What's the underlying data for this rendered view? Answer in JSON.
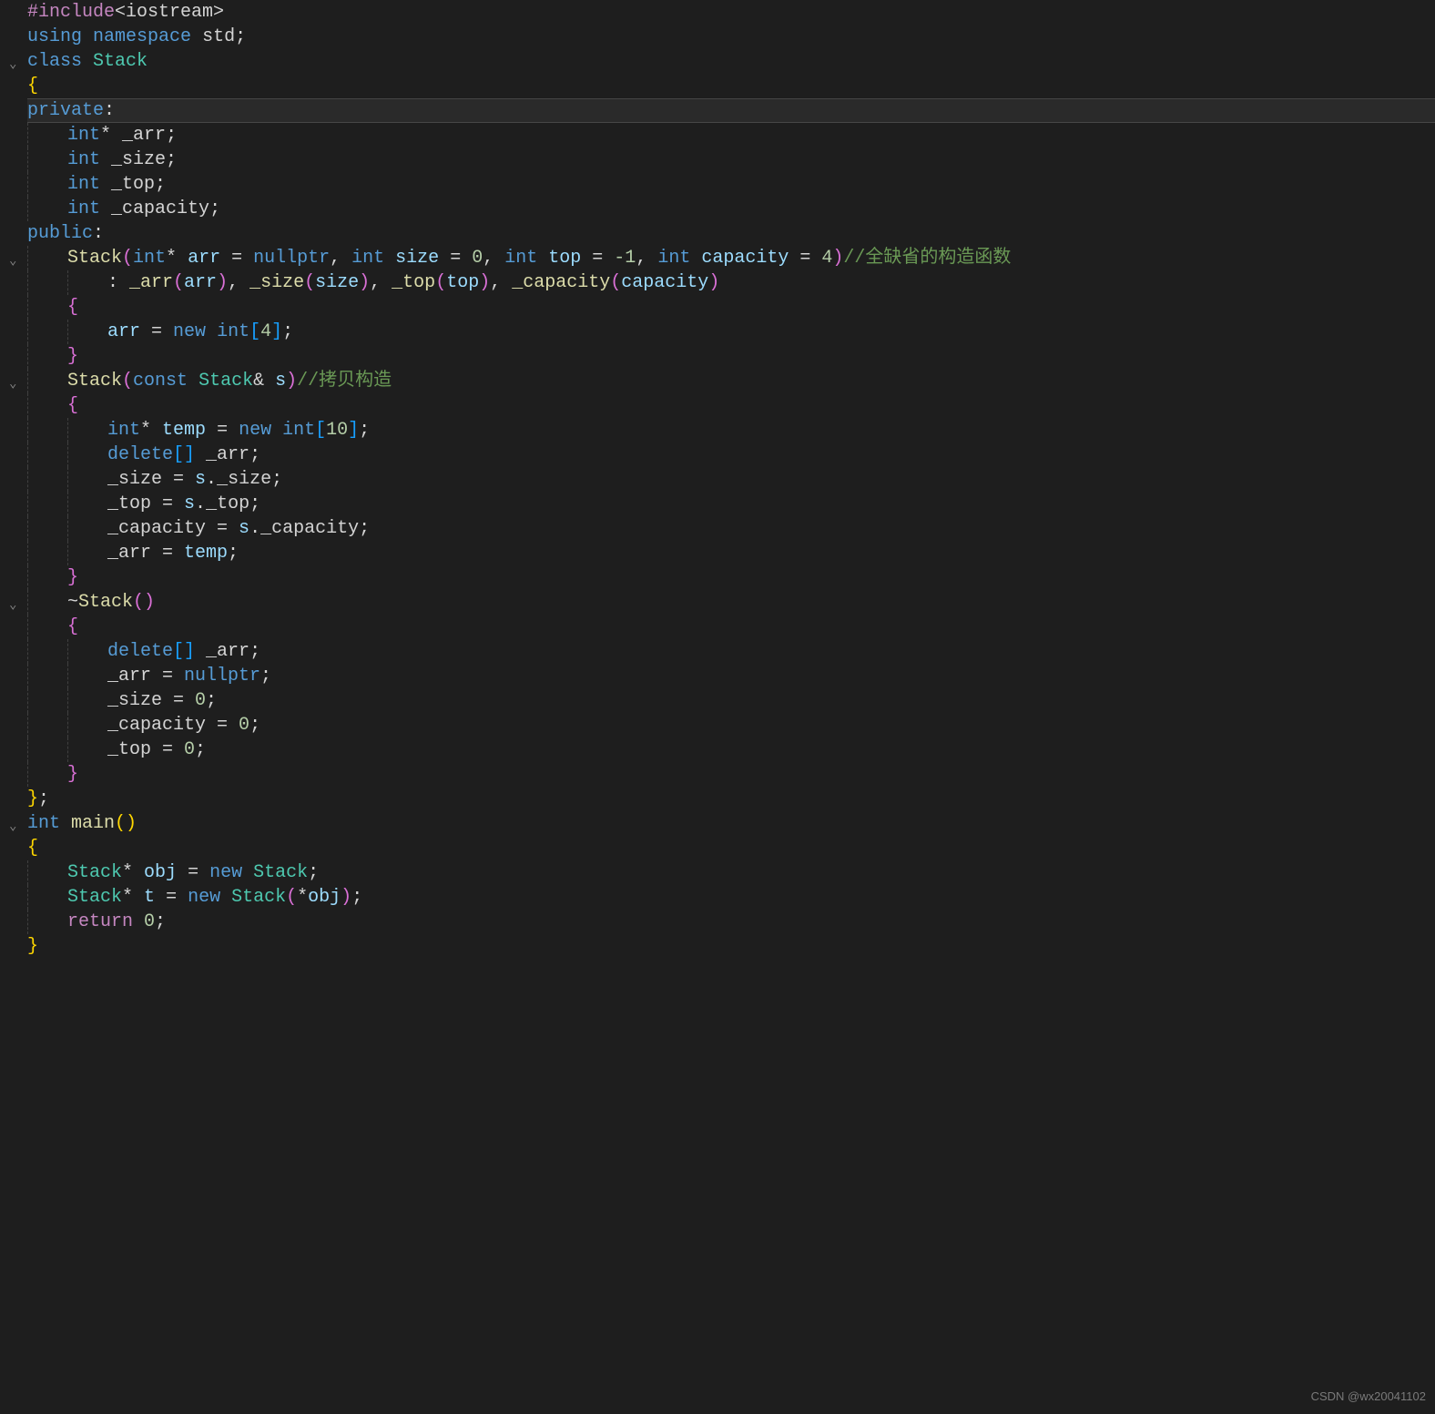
{
  "watermark": "CSDN @wx20041102",
  "lines": [
    {
      "indent": 0,
      "fold": "",
      "tokens": [
        {
          "t": "#include",
          "c": "c-preproc"
        },
        {
          "t": "<iostream>",
          "c": "c-punct"
        }
      ]
    },
    {
      "indent": 0,
      "fold": "",
      "tokens": [
        {
          "t": "using",
          "c": "c-keyword"
        },
        {
          "t": " ",
          "c": ""
        },
        {
          "t": "namespace",
          "c": "c-keyword"
        },
        {
          "t": " ",
          "c": ""
        },
        {
          "t": "std",
          "c": "c-white"
        },
        {
          "t": ";",
          "c": "c-punct"
        }
      ]
    },
    {
      "indent": 0,
      "fold": "v",
      "tokens": [
        {
          "t": "class",
          "c": "c-keyword"
        },
        {
          "t": " ",
          "c": ""
        },
        {
          "t": "Stack",
          "c": "c-class"
        }
      ]
    },
    {
      "indent": 0,
      "fold": "",
      "guides": [
        0
      ],
      "tokens": [
        {
          "t": "{",
          "c": "bracket1"
        }
      ]
    },
    {
      "indent": 0,
      "fold": "",
      "guides": [
        0
      ],
      "highlight": true,
      "tokens": [
        {
          "t": "private",
          "c": "c-keyword"
        },
        {
          "t": ":",
          "c": "c-punct"
        }
      ]
    },
    {
      "indent": 4,
      "fold": "",
      "guides": [
        0,
        4
      ],
      "tokens": [
        {
          "t": "int",
          "c": "c-type"
        },
        {
          "t": "*",
          "c": "c-op"
        },
        {
          "t": " ",
          "c": ""
        },
        {
          "t": "_arr",
          "c": "c-white"
        },
        {
          "t": ";",
          "c": "c-punct"
        }
      ]
    },
    {
      "indent": 4,
      "fold": "",
      "guides": [
        0,
        4
      ],
      "tokens": [
        {
          "t": "int",
          "c": "c-type"
        },
        {
          "t": " ",
          "c": ""
        },
        {
          "t": "_size",
          "c": "c-white"
        },
        {
          "t": ";",
          "c": "c-punct"
        }
      ]
    },
    {
      "indent": 4,
      "fold": "",
      "guides": [
        0,
        4
      ],
      "tokens": [
        {
          "t": "int",
          "c": "c-type"
        },
        {
          "t": " ",
          "c": ""
        },
        {
          "t": "_top",
          "c": "c-white"
        },
        {
          "t": ";",
          "c": "c-punct"
        }
      ]
    },
    {
      "indent": 4,
      "fold": "",
      "guides": [
        0,
        4
      ],
      "tokens": [
        {
          "t": "int",
          "c": "c-type"
        },
        {
          "t": " ",
          "c": ""
        },
        {
          "t": "_capacity",
          "c": "c-white"
        },
        {
          "t": ";",
          "c": "c-punct"
        }
      ]
    },
    {
      "indent": 0,
      "fold": "",
      "guides": [
        0
      ],
      "tokens": [
        {
          "t": "public",
          "c": "c-keyword"
        },
        {
          "t": ":",
          "c": "c-punct"
        }
      ]
    },
    {
      "indent": 4,
      "fold": "v",
      "guides": [
        0,
        4
      ],
      "tokens": [
        {
          "t": "Stack",
          "c": "c-func"
        },
        {
          "t": "(",
          "c": "bracket2"
        },
        {
          "t": "int",
          "c": "c-type"
        },
        {
          "t": "*",
          "c": "c-op"
        },
        {
          "t": " ",
          "c": ""
        },
        {
          "t": "arr",
          "c": "c-param"
        },
        {
          "t": " = ",
          "c": "c-op"
        },
        {
          "t": "nullptr",
          "c": "c-nullptr"
        },
        {
          "t": ", ",
          "c": "c-punct"
        },
        {
          "t": "int",
          "c": "c-type"
        },
        {
          "t": " ",
          "c": ""
        },
        {
          "t": "size",
          "c": "c-param"
        },
        {
          "t": " = ",
          "c": "c-op"
        },
        {
          "t": "0",
          "c": "c-num"
        },
        {
          "t": ", ",
          "c": "c-punct"
        },
        {
          "t": "int",
          "c": "c-type"
        },
        {
          "t": " ",
          "c": ""
        },
        {
          "t": "top",
          "c": "c-param"
        },
        {
          "t": " = ",
          "c": "c-op"
        },
        {
          "t": "-1",
          "c": "c-num"
        },
        {
          "t": ", ",
          "c": "c-punct"
        },
        {
          "t": "int",
          "c": "c-type"
        },
        {
          "t": " ",
          "c": ""
        },
        {
          "t": "capacity",
          "c": "c-param"
        },
        {
          "t": " = ",
          "c": "c-op"
        },
        {
          "t": "4",
          "c": "c-num"
        },
        {
          "t": ")",
          "c": "bracket2"
        },
        {
          "t": "//全缺省的构造函数",
          "c": "c-comment"
        }
      ]
    },
    {
      "indent": 8,
      "fold": "",
      "guides": [
        0,
        4,
        8
      ],
      "tokens": [
        {
          "t": ": ",
          "c": "c-punct"
        },
        {
          "t": "_arr",
          "c": "c-func"
        },
        {
          "t": "(",
          "c": "bracket2"
        },
        {
          "t": "arr",
          "c": "c-param"
        },
        {
          "t": ")",
          "c": "bracket2"
        },
        {
          "t": ", ",
          "c": "c-punct"
        },
        {
          "t": "_size",
          "c": "c-func"
        },
        {
          "t": "(",
          "c": "bracket2"
        },
        {
          "t": "size",
          "c": "c-param"
        },
        {
          "t": ")",
          "c": "bracket2"
        },
        {
          "t": ", ",
          "c": "c-punct"
        },
        {
          "t": "_top",
          "c": "c-func"
        },
        {
          "t": "(",
          "c": "bracket2"
        },
        {
          "t": "top",
          "c": "c-param"
        },
        {
          "t": ")",
          "c": "bracket2"
        },
        {
          "t": ", ",
          "c": "c-punct"
        },
        {
          "t": "_capacity",
          "c": "c-func"
        },
        {
          "t": "(",
          "c": "bracket2"
        },
        {
          "t": "capacity",
          "c": "c-param"
        },
        {
          "t": ")",
          "c": "bracket2"
        }
      ]
    },
    {
      "indent": 4,
      "fold": "",
      "guides": [
        0,
        4
      ],
      "tokens": [
        {
          "t": "{",
          "c": "bracket2"
        }
      ]
    },
    {
      "indent": 8,
      "fold": "",
      "guides": [
        0,
        4,
        8
      ],
      "tokens": [
        {
          "t": "arr",
          "c": "c-param"
        },
        {
          "t": " = ",
          "c": "c-op"
        },
        {
          "t": "new",
          "c": "c-keyword"
        },
        {
          "t": " ",
          "c": ""
        },
        {
          "t": "int",
          "c": "c-type"
        },
        {
          "t": "[",
          "c": "bracket3"
        },
        {
          "t": "4",
          "c": "c-num"
        },
        {
          "t": "]",
          "c": "bracket3"
        },
        {
          "t": ";",
          "c": "c-punct"
        }
      ]
    },
    {
      "indent": 4,
      "fold": "",
      "guides": [
        0,
        4
      ],
      "tokens": [
        {
          "t": "}",
          "c": "bracket2"
        }
      ]
    },
    {
      "indent": 4,
      "fold": "v",
      "guides": [
        0,
        4
      ],
      "tokens": [
        {
          "t": "Stack",
          "c": "c-func"
        },
        {
          "t": "(",
          "c": "bracket2"
        },
        {
          "t": "const",
          "c": "c-keyword"
        },
        {
          "t": " ",
          "c": ""
        },
        {
          "t": "Stack",
          "c": "c-class"
        },
        {
          "t": "&",
          "c": "c-op"
        },
        {
          "t": " ",
          "c": ""
        },
        {
          "t": "s",
          "c": "c-param"
        },
        {
          "t": ")",
          "c": "bracket2"
        },
        {
          "t": "//拷贝构造",
          "c": "c-comment"
        }
      ]
    },
    {
      "indent": 4,
      "fold": "",
      "guides": [
        0,
        4
      ],
      "tokens": [
        {
          "t": "{",
          "c": "bracket2"
        }
      ]
    },
    {
      "indent": 8,
      "fold": "",
      "guides": [
        0,
        4,
        8
      ],
      "tokens": [
        {
          "t": "int",
          "c": "c-type"
        },
        {
          "t": "*",
          "c": "c-op"
        },
        {
          "t": " ",
          "c": ""
        },
        {
          "t": "temp",
          "c": "c-var"
        },
        {
          "t": " = ",
          "c": "c-op"
        },
        {
          "t": "new",
          "c": "c-keyword"
        },
        {
          "t": " ",
          "c": ""
        },
        {
          "t": "int",
          "c": "c-type"
        },
        {
          "t": "[",
          "c": "bracket3"
        },
        {
          "t": "10",
          "c": "c-num"
        },
        {
          "t": "]",
          "c": "bracket3"
        },
        {
          "t": ";",
          "c": "c-punct"
        }
      ]
    },
    {
      "indent": 8,
      "fold": "",
      "guides": [
        0,
        4,
        8
      ],
      "tokens": [
        {
          "t": "delete",
          "c": "c-keyword"
        },
        {
          "t": "[]",
          "c": "bracket3"
        },
        {
          "t": " ",
          "c": ""
        },
        {
          "t": "_arr",
          "c": "c-white"
        },
        {
          "t": ";",
          "c": "c-punct"
        }
      ]
    },
    {
      "indent": 8,
      "fold": "",
      "guides": [
        0,
        4,
        8
      ],
      "tokens": [
        {
          "t": "_size",
          "c": "c-white"
        },
        {
          "t": " = ",
          "c": "c-op"
        },
        {
          "t": "s",
          "c": "c-param"
        },
        {
          "t": ".",
          "c": "c-punct"
        },
        {
          "t": "_size",
          "c": "c-white"
        },
        {
          "t": ";",
          "c": "c-punct"
        }
      ]
    },
    {
      "indent": 8,
      "fold": "",
      "guides": [
        0,
        4,
        8
      ],
      "tokens": [
        {
          "t": "_top",
          "c": "c-white"
        },
        {
          "t": " = ",
          "c": "c-op"
        },
        {
          "t": "s",
          "c": "c-param"
        },
        {
          "t": ".",
          "c": "c-punct"
        },
        {
          "t": "_top",
          "c": "c-white"
        },
        {
          "t": ";",
          "c": "c-punct"
        }
      ]
    },
    {
      "indent": 8,
      "fold": "",
      "guides": [
        0,
        4,
        8
      ],
      "tokens": [
        {
          "t": "_capacity",
          "c": "c-white"
        },
        {
          "t": " = ",
          "c": "c-op"
        },
        {
          "t": "s",
          "c": "c-param"
        },
        {
          "t": ".",
          "c": "c-punct"
        },
        {
          "t": "_capacity",
          "c": "c-white"
        },
        {
          "t": ";",
          "c": "c-punct"
        }
      ]
    },
    {
      "indent": 8,
      "fold": "",
      "guides": [
        0,
        4,
        8
      ],
      "tokens": [
        {
          "t": "_arr",
          "c": "c-white"
        },
        {
          "t": " = ",
          "c": "c-op"
        },
        {
          "t": "temp",
          "c": "c-var"
        },
        {
          "t": ";",
          "c": "c-punct"
        }
      ]
    },
    {
      "indent": 4,
      "fold": "",
      "guides": [
        0,
        4
      ],
      "tokens": [
        {
          "t": "}",
          "c": "bracket2"
        }
      ]
    },
    {
      "indent": 4,
      "fold": "v",
      "guides": [
        0,
        4
      ],
      "tokens": [
        {
          "t": "~",
          "c": "c-punct"
        },
        {
          "t": "Stack",
          "c": "c-func"
        },
        {
          "t": "()",
          "c": "bracket2"
        }
      ]
    },
    {
      "indent": 4,
      "fold": "",
      "guides": [
        0,
        4
      ],
      "tokens": [
        {
          "t": "{",
          "c": "bracket2"
        }
      ]
    },
    {
      "indent": 8,
      "fold": "",
      "guides": [
        0,
        4,
        8
      ],
      "tokens": [
        {
          "t": "delete",
          "c": "c-keyword"
        },
        {
          "t": "[]",
          "c": "bracket3"
        },
        {
          "t": " ",
          "c": ""
        },
        {
          "t": "_arr",
          "c": "c-white"
        },
        {
          "t": ";",
          "c": "c-punct"
        }
      ]
    },
    {
      "indent": 8,
      "fold": "",
      "guides": [
        0,
        4,
        8
      ],
      "tokens": [
        {
          "t": "_arr",
          "c": "c-white"
        },
        {
          "t": " = ",
          "c": "c-op"
        },
        {
          "t": "nullptr",
          "c": "c-nullptr"
        },
        {
          "t": ";",
          "c": "c-punct"
        }
      ]
    },
    {
      "indent": 8,
      "fold": "",
      "guides": [
        0,
        4,
        8
      ],
      "tokens": [
        {
          "t": "_size",
          "c": "c-white"
        },
        {
          "t": " = ",
          "c": "c-op"
        },
        {
          "t": "0",
          "c": "c-num"
        },
        {
          "t": ";",
          "c": "c-punct"
        }
      ]
    },
    {
      "indent": 8,
      "fold": "",
      "guides": [
        0,
        4,
        8
      ],
      "tokens": [
        {
          "t": "_capacity",
          "c": "c-white"
        },
        {
          "t": " = ",
          "c": "c-op"
        },
        {
          "t": "0",
          "c": "c-num"
        },
        {
          "t": ";",
          "c": "c-punct"
        }
      ]
    },
    {
      "indent": 8,
      "fold": "",
      "guides": [
        0,
        4,
        8
      ],
      "tokens": [
        {
          "t": "_top",
          "c": "c-white"
        },
        {
          "t": " = ",
          "c": "c-op"
        },
        {
          "t": "0",
          "c": "c-num"
        },
        {
          "t": ";",
          "c": "c-punct"
        }
      ]
    },
    {
      "indent": 4,
      "fold": "",
      "guides": [
        0,
        4
      ],
      "tokens": [
        {
          "t": "}",
          "c": "bracket2"
        }
      ]
    },
    {
      "indent": 0,
      "fold": "",
      "guides": [
        0
      ],
      "tokens": [
        {
          "t": "}",
          "c": "bracket1"
        },
        {
          "t": ";",
          "c": "c-punct"
        }
      ]
    },
    {
      "indent": 0,
      "fold": "v",
      "tokens": [
        {
          "t": "int",
          "c": "c-type"
        },
        {
          "t": " ",
          "c": ""
        },
        {
          "t": "main",
          "c": "c-func"
        },
        {
          "t": "()",
          "c": "bracket1"
        }
      ]
    },
    {
      "indent": 0,
      "fold": "",
      "guides": [
        0
      ],
      "tokens": [
        {
          "t": "{",
          "c": "bracket1"
        }
      ]
    },
    {
      "indent": 4,
      "fold": "",
      "guides": [
        0,
        4
      ],
      "tokens": [
        {
          "t": "Stack",
          "c": "c-class"
        },
        {
          "t": "*",
          "c": "c-op"
        },
        {
          "t": " ",
          "c": ""
        },
        {
          "t": "obj",
          "c": "c-var"
        },
        {
          "t": " = ",
          "c": "c-op"
        },
        {
          "t": "new",
          "c": "c-keyword"
        },
        {
          "t": " ",
          "c": ""
        },
        {
          "t": "Stack",
          "c": "c-class"
        },
        {
          "t": ";",
          "c": "c-punct"
        }
      ]
    },
    {
      "indent": 4,
      "fold": "",
      "guides": [
        0,
        4
      ],
      "tokens": [
        {
          "t": "Stack",
          "c": "c-class"
        },
        {
          "t": "*",
          "c": "c-op"
        },
        {
          "t": " ",
          "c": ""
        },
        {
          "t": "t",
          "c": "c-var"
        },
        {
          "t": " = ",
          "c": "c-op"
        },
        {
          "t": "new",
          "c": "c-keyword"
        },
        {
          "t": " ",
          "c": ""
        },
        {
          "t": "Stack",
          "c": "c-class"
        },
        {
          "t": "(",
          "c": "bracket2"
        },
        {
          "t": "*",
          "c": "c-op"
        },
        {
          "t": "obj",
          "c": "c-var"
        },
        {
          "t": ")",
          "c": "bracket2"
        },
        {
          "t": ";",
          "c": "c-punct"
        }
      ]
    },
    {
      "indent": 4,
      "fold": "",
      "guides": [
        0,
        4
      ],
      "tokens": [
        {
          "t": "return",
          "c": "c-preproc"
        },
        {
          "t": " ",
          "c": ""
        },
        {
          "t": "0",
          "c": "c-num"
        },
        {
          "t": ";",
          "c": "c-punct"
        }
      ]
    },
    {
      "indent": 0,
      "fold": "",
      "guides": [
        0
      ],
      "tokens": [
        {
          "t": "}",
          "c": "bracket1"
        }
      ]
    }
  ]
}
